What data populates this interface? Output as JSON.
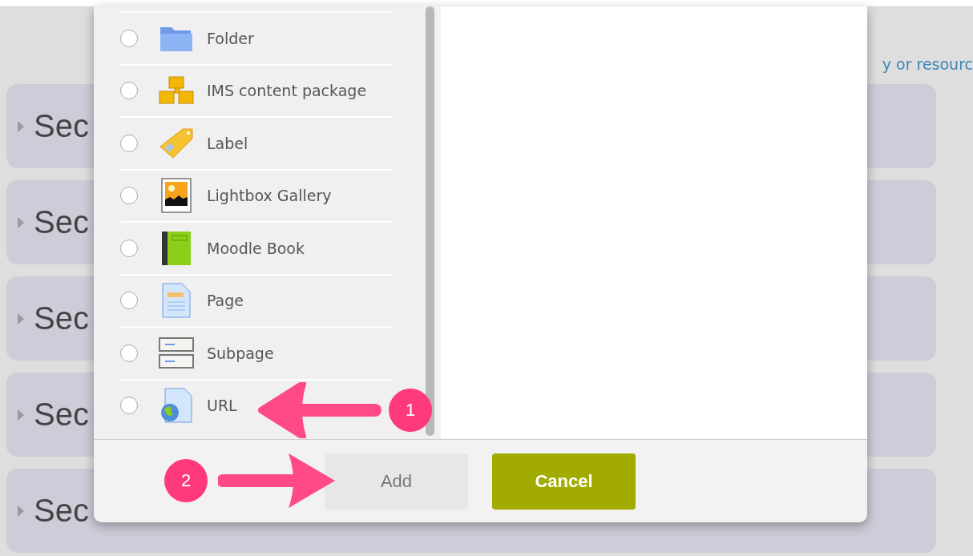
{
  "page": {
    "add_link": "y or resourc"
  },
  "sections": [
    {
      "title": "Sec"
    },
    {
      "title": "Sec"
    },
    {
      "title": "Sec"
    },
    {
      "title": "Sec"
    },
    {
      "title": "Sec"
    }
  ],
  "dialog": {
    "items": [
      {
        "label": "Folder",
        "kind": "folder",
        "selected": false
      },
      {
        "label": "IMS content package",
        "kind": "package",
        "selected": false
      },
      {
        "label": "Label",
        "kind": "tag",
        "selected": false
      },
      {
        "label": "Lightbox Gallery",
        "kind": "gallery",
        "selected": false
      },
      {
        "label": "Moodle Book",
        "kind": "book",
        "selected": false
      },
      {
        "label": "Page",
        "kind": "page",
        "selected": false
      },
      {
        "label": "Subpage",
        "kind": "subpage",
        "selected": false
      },
      {
        "label": "URL",
        "kind": "url",
        "selected": false
      }
    ],
    "buttons": [
      {
        "label": "Add",
        "kind": "default"
      },
      {
        "label": "Cancel",
        "kind": "primary"
      }
    ]
  },
  "annotations": [
    {
      "number": "1"
    },
    {
      "number": "2"
    }
  ]
}
